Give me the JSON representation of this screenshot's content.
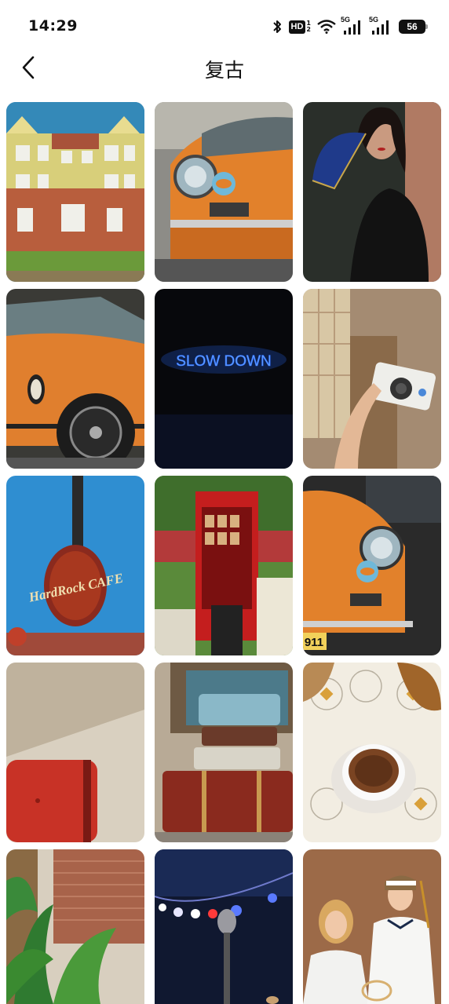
{
  "status_bar": {
    "time": "14:29",
    "icons": [
      "bluetooth-icon",
      "hd-icon",
      "wifi-icon",
      "signal-5g-icon",
      "signal-5g-icon",
      "battery-icon"
    ],
    "hd_label": "HD",
    "hd_sub_top": "1",
    "hd_sub_bottom": "2",
    "network_label_1": "5G",
    "network_label_2": "5G",
    "battery_level": "56"
  },
  "header": {
    "back_icon": "chevron-left-icon",
    "title": "复古"
  },
  "gallery": {
    "columns": 3,
    "items": [
      {
        "subject": "yellow-townhouse"
      },
      {
        "subject": "orange-porsche-gulf-front"
      },
      {
        "subject": "woman-with-blue-fan"
      },
      {
        "subject": "orange-porsche-side"
      },
      {
        "subject": "neon-sign",
        "text": "SLOW DOWN"
      },
      {
        "subject": "hand-holding-camera"
      },
      {
        "subject": "hard-rock-cafe-guitar-sign",
        "text": "HardRock CAFE"
      },
      {
        "subject": "red-telephone-booth"
      },
      {
        "subject": "orange-porsche-911-headlight",
        "text": "911"
      },
      {
        "subject": "red-chair-sunlight"
      },
      {
        "subject": "vintage-suitcases"
      },
      {
        "subject": "coffee-cup-on-lace"
      },
      {
        "subject": "plants-brick-wall"
      },
      {
        "subject": "microphone-stage-lights"
      },
      {
        "subject": "couple-tennis-outfits"
      }
    ]
  },
  "colors": {
    "background": "#ffffff",
    "text": "#111111",
    "accent_orange": "#e2812b",
    "neon_blue": "#3a7bff"
  }
}
